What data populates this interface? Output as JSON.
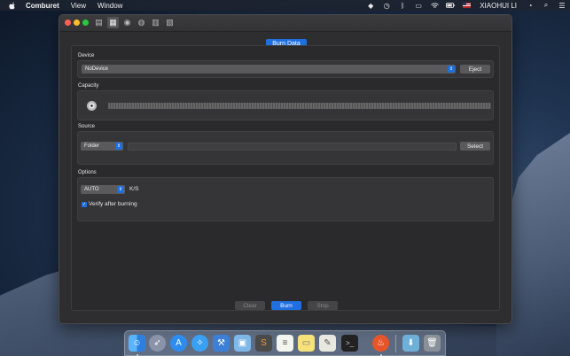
{
  "menubar": {
    "app_name": "Comburet",
    "menus": [
      "View",
      "Window"
    ],
    "user": "XIAOHUI LI",
    "status_icons": [
      "evernote-icon",
      "time-machine-icon",
      "bluetooth-icon",
      "airplay-icon",
      "wifi-icon",
      "battery-icon",
      "flag-icon",
      "user-icon",
      "timer-icon",
      "spotlight-icon",
      "list-icon"
    ]
  },
  "window": {
    "toolbar": [
      "burn-data-icon",
      "burn-files-icon",
      "copy-disc-icon",
      "erase-icon",
      "image-icon",
      "info-icon"
    ],
    "title": "Burn Data",
    "device": {
      "label": "Device",
      "selected": "NoDevice",
      "eject_label": "Eject"
    },
    "capacity": {
      "label": "Capacity"
    },
    "source": {
      "label": "Source",
      "selected": "Folder",
      "path": "",
      "select_label": "Select"
    },
    "options": {
      "label": "Options",
      "speed": "AUTO",
      "speed_unit": "K/S",
      "verify_label": "Verify after burning",
      "verify_checked": true
    },
    "actions": {
      "clear": "Clear",
      "burn": "Burn",
      "stop": "Stop"
    }
  },
  "dock": {
    "apps": [
      "finder-icon",
      "launchpad-icon",
      "app-store-icon",
      "safari-icon",
      "xcode-icon",
      "virtualbox-icon",
      "sublime-icon",
      "notes-icon",
      "stickies-icon",
      "textedit-icon",
      "terminal-icon",
      "comburet-icon",
      "downloads-icon",
      "trash-icon"
    ]
  }
}
